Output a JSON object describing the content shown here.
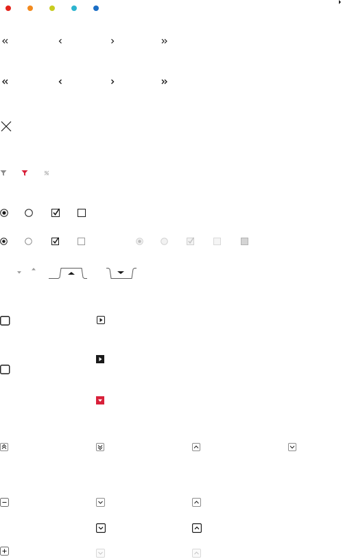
{
  "colors": {
    "dots": [
      "#e3231b",
      "#f28a1e",
      "#c8cc1f",
      "#2cb4cf",
      "#1b6ec5"
    ],
    "ink": "#1a1a1a",
    "accent": "#d8203a",
    "grey": "#8c8c8c",
    "light": "#c8c8c8"
  },
  "icons": {
    "corner": "caret-right-icon",
    "pager_row_1": [
      "double-chevron-left-icon",
      "chevron-left-icon",
      "chevron-right-icon",
      "double-chevron-right-icon"
    ],
    "pager_row_2": [
      "double-chevron-left-icon",
      "chevron-left-icon",
      "chevron-right-icon",
      "double-chevron-right-icon"
    ],
    "close": "close-icon",
    "filters": [
      "filter-icon",
      "filter-active-icon",
      "filter-clear-icon"
    ],
    "checks_row_1": [
      "radio-checked-icon",
      "radio-unchecked-icon",
      "checkbox-checked-icon",
      "checkbox-unchecked-icon"
    ],
    "checks_row_2_enabled": [
      "radio-checked-icon",
      "radio-unchecked-icon",
      "checkbox-checked-icon",
      "checkbox-unchecked-icon"
    ],
    "checks_row_2_disabled": [
      "radio-checked-disabled-icon",
      "radio-unchecked-disabled-icon",
      "checkbox-checked-disabled-icon",
      "checkbox-unchecked-disabled-icon",
      "checkbox-indeterminate-disabled-icon"
    ],
    "sort": [
      "sort-down-icon",
      "sort-up-icon",
      "tab-caret-up-icon",
      "tab-caret-down-icon"
    ],
    "toggles": [
      "square-toggle-icon",
      "square-toggle-icon",
      "play-box-icon",
      "play-box-filled-icon",
      "dropdown-box-accent-icon"
    ],
    "collapse_row": [
      "double-chevron-up-box-icon",
      "double-chevron-down-box-icon",
      "chevron-up-box-icon",
      "chevron-down-box-icon"
    ],
    "expand": [
      "minus-box-icon",
      "plus-box-icon"
    ],
    "chevron_boxes": [
      "chevron-down-box-icon",
      "chevron-up-box-icon",
      "chevron-down-box-bold-icon",
      "chevron-up-box-bold-icon",
      "chevron-down-box-disabled-icon",
      "chevron-up-box-disabled-icon"
    ]
  }
}
